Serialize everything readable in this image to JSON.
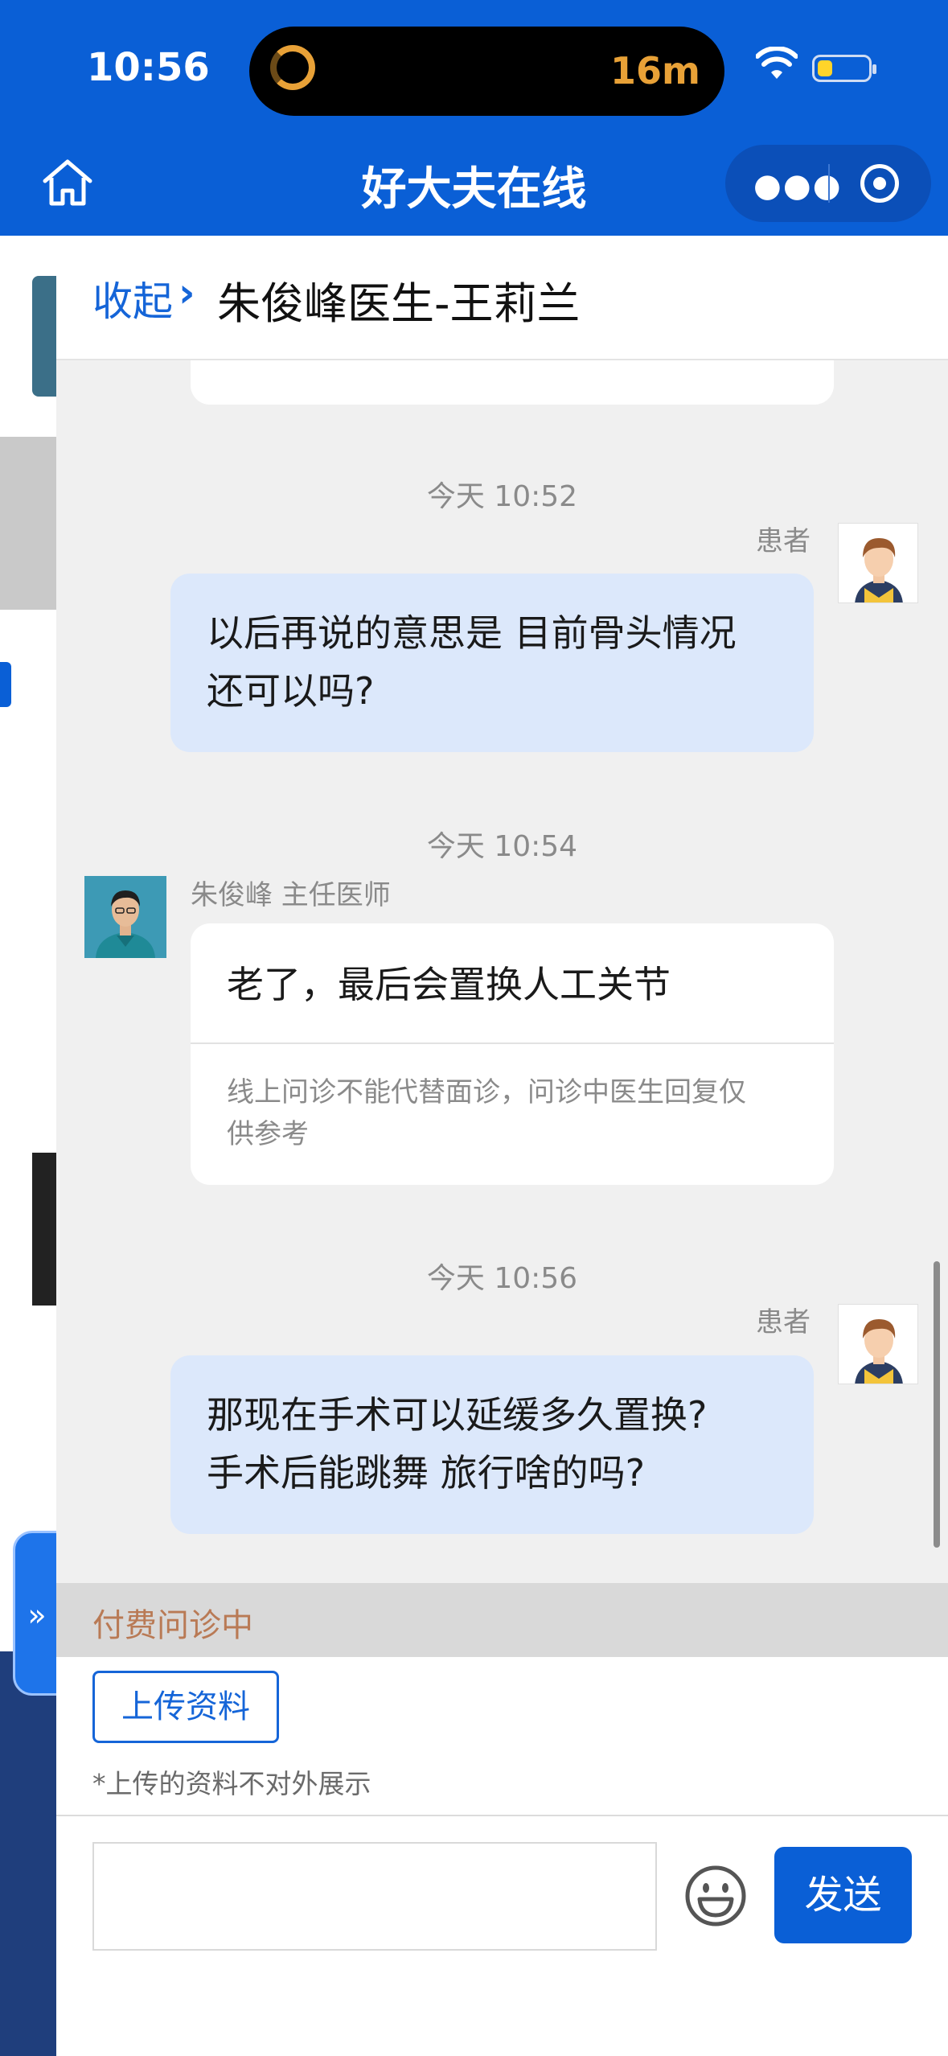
{
  "status_bar": {
    "time": "10:56",
    "island_timer": "16m"
  },
  "nav": {
    "title": "好大夫在线"
  },
  "chat_header": {
    "collapse_label": "收起",
    "title": "朱俊峰医生-王莉兰"
  },
  "messages": [
    {
      "timestamp": "今天 10:52",
      "sender": "患者",
      "text_line1": "以后再说的意思是 目前骨头情况",
      "text_line2": "还可以吗?"
    },
    {
      "timestamp": "今天 10:54",
      "sender": "朱俊峰 主任医师",
      "text": "老了，最后会置换人工关节",
      "disclaimer_line1": "线上问诊不能代替面诊，问诊中医生回复仅",
      "disclaimer_line2": "供参考"
    },
    {
      "timestamp": "今天 10:56",
      "sender": "患者",
      "text_line1": "那现在手术可以延缓多久置换?",
      "text_line2": "手术后能跳舞 旅行啥的吗?"
    }
  ],
  "consult_status": "付费问诊中",
  "upload": {
    "button_label": "上传资料",
    "note": "*上传的资料不对外展示"
  },
  "composer": {
    "input_value": "",
    "send_label": "发送"
  },
  "side_tab": {
    "label": "»"
  },
  "colors": {
    "brand_blue": "#0a5fd6",
    "patient_bubble": "#dce8fb",
    "status_text": "#b97a55"
  },
  "icons": [
    "home-icon",
    "more-dots-icon",
    "target-icon",
    "wifi-icon",
    "battery-icon",
    "emoji-icon",
    "chevron-right-icon"
  ]
}
